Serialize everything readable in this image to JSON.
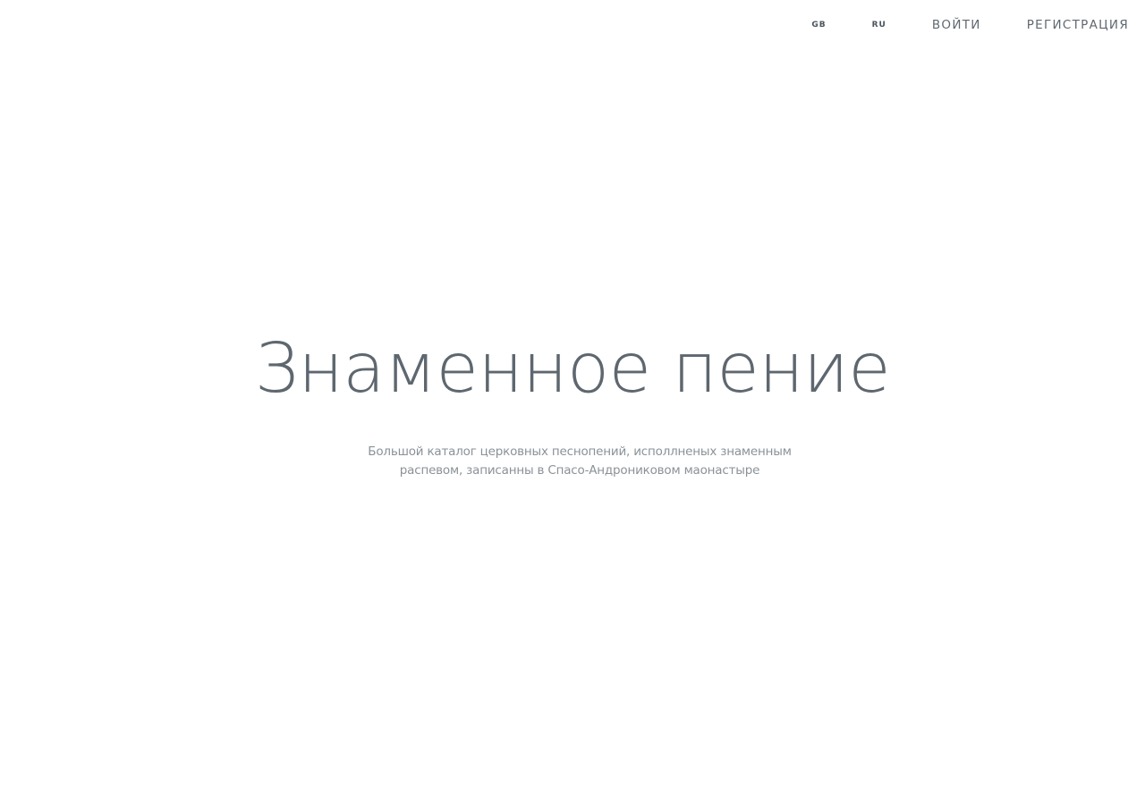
{
  "nav": {
    "lang_gb": "GB",
    "lang_ru": "RU",
    "login": "ВОЙТИ",
    "register": "РЕГИСТРАЦИЯ"
  },
  "hero": {
    "title": "Знаменное пение",
    "subtitle": "Большой каталог церковных песнопений, исполлненых знаменным распевом, записанны в Спасо-Андрониковом маонастыре"
  },
  "colors": {
    "text": "#5e676f",
    "subtitle": "#8a9298",
    "background": "#ffffff"
  }
}
